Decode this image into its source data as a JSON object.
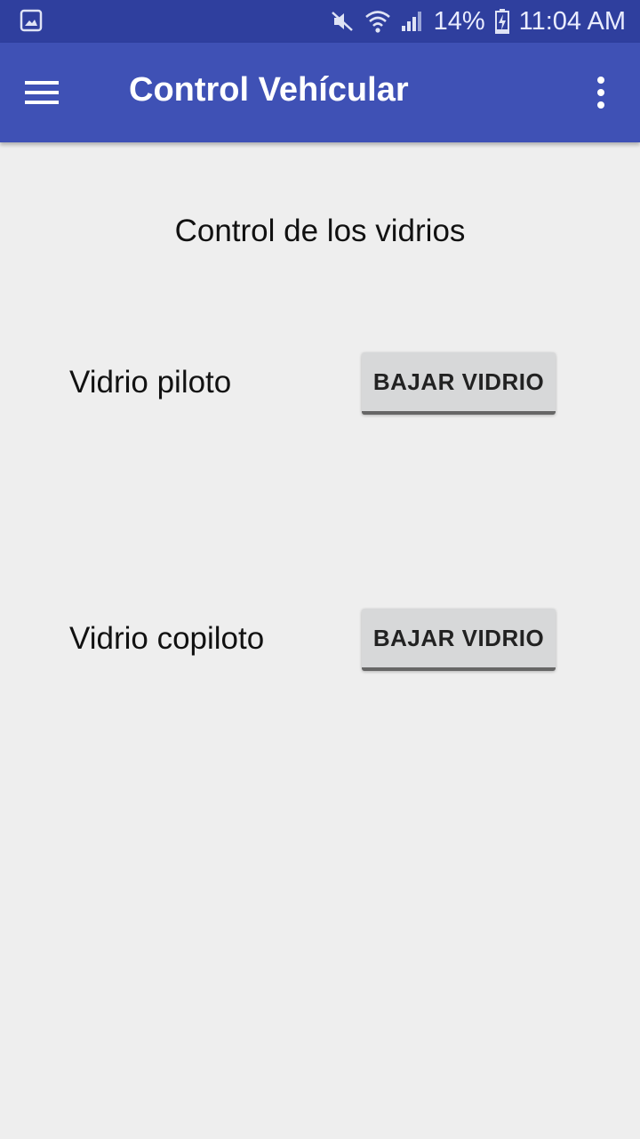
{
  "status_bar": {
    "left_icon": "gallery-notification-icon",
    "icons": [
      "mute-icon",
      "wifi-icon",
      "signal-icon"
    ],
    "battery_percent": "14%",
    "battery_icon": "battery-charging-icon",
    "time": "11:04 AM"
  },
  "app_bar": {
    "title": "Control Vehícular",
    "menu_icon": "hamburger-menu-icon",
    "overflow_icon": "overflow-menu-icon",
    "color": "#3f51b5",
    "status_color": "#2f3f9e"
  },
  "main": {
    "section_title": "Control de los vidrios",
    "rows": [
      {
        "label": "Vidrio piloto",
        "button_label": "BAJAR VIDRIO"
      },
      {
        "label": "Vidrio copiloto",
        "button_label": "BAJAR VIDRIO"
      }
    ]
  }
}
